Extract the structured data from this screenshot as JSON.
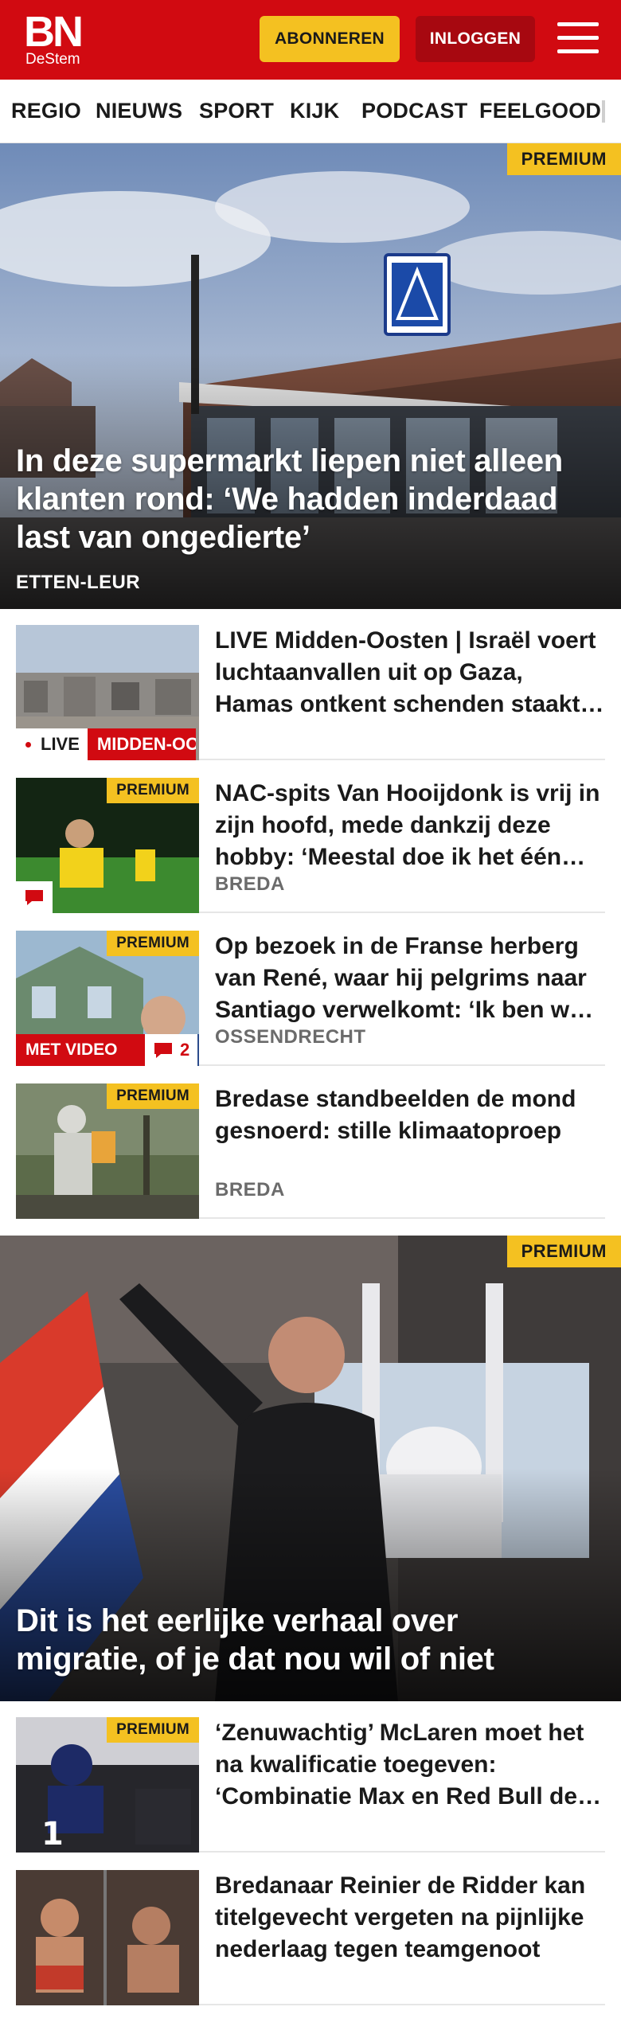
{
  "header": {
    "logo_main": "BN",
    "logo_sub": "DeStem",
    "subscribe_label": "ABONNEREN",
    "login_label": "INLOGGEN",
    "menu_icon": "hamburger-menu-icon",
    "brand_color": "#d10a11",
    "accent_color": "#f4c121"
  },
  "nav": {
    "items": [
      "REGIO",
      "NIEUWS",
      "SPORT",
      "KIJK",
      "PODCAST",
      "FEELGOOD"
    ]
  },
  "hero1": {
    "premium_label": "PREMIUM",
    "title": "In deze supermarkt liepen niet alleen klanten rond: ‘We hadden inderdaad last van ongedierte’",
    "location": "ETTEN-LEUR"
  },
  "articles": [
    {
      "headline": "LIVE Midden-Oosten | Israël voert luchtaanvallen uit op Gaza, Hamas ontkent schenden staakt-het-vuren",
      "live_label": "LIVE",
      "tag_label": "MIDDEN-OOSTEN"
    },
    {
      "headline": "NAC-spits Van Hooijdonk is vrij in zijn hoofd, mede dankzij deze hobby: ‘Meestal doe ik het één keer per week’",
      "premium_label": "PREMIUM",
      "location": "BREDA",
      "comment_icon": "comment-icon"
    },
    {
      "headline": "Op bezoek in de Franse herberg van René, waar hij pelgrims naar Santiago verwelkomt: ‘Ik ben wel een beetje een idealist’",
      "premium_label": "PREMIUM",
      "location": "OSSENDRECHT",
      "video_label": "MET VIDEO",
      "comment_count": "2"
    },
    {
      "headline": "Bredase standbeelden de mond gesnoerd: stille klimaatoproep",
      "premium_label": "PREMIUM",
      "location": "BREDA"
    }
  ],
  "hero2": {
    "premium_label": "PREMIUM",
    "title": "Dit is het eerlijke verhaal over migratie, of je dat nou wil of niet"
  },
  "articles2": [
    {
      "headline": "‘Zenuwachtig’ McLaren moet het na kwalificatie toegeven: ‘Combinatie Max en Red Bull deze week te sterk’",
      "premium_label": "PREMIUM"
    },
    {
      "headline": "Bredanaar Reinier de Ridder kan titelgevecht vergeten na pijnlijke nederlaag tegen teamgenoot"
    }
  ]
}
